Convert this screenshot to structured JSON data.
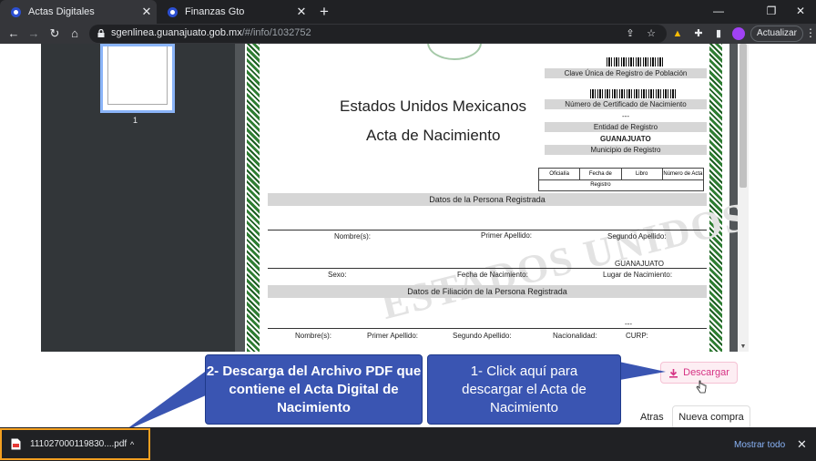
{
  "browser": {
    "tabs": [
      {
        "title": "Actas Digitales",
        "active": true
      },
      {
        "title": "Finanzas Gto",
        "active": false
      }
    ],
    "close_glyph": "✕",
    "new_tab_glyph": "+",
    "window_controls": {
      "minimize": "—",
      "restore": "❐",
      "close": "✕"
    },
    "nav": {
      "back": "←",
      "forward": "→",
      "reload": "↻",
      "home": "⌂"
    },
    "url": {
      "domain": "sgenlinea.guanajuato.gob.mx",
      "path": "/#/info/1032752"
    },
    "update_label": "Actualizar",
    "menu_glyph": "⋮",
    "icons": [
      "share-icon",
      "star-icon",
      "extension-icon",
      "puzzle-icon",
      "sidepanel-icon",
      "profile-icon"
    ]
  },
  "viewer": {
    "thumbnail_page": "1",
    "document": {
      "title_country": "Estados Unidos Mexicanos",
      "title_doc": "Acta de Nacimiento",
      "watermark": "ESTADOS UNIDOS MEXICANOS",
      "curp_label": "Clave Única de Registro de Población",
      "cert_label": "Número de Certificado de Nacimiento",
      "cert_value": "---",
      "entity_label": "Entidad de Registro",
      "entity_value": "GUANAJUATO",
      "municipality_label": "Municipio de Registro",
      "table_headers": [
        "Oficialía",
        "Fecha de Registro",
        "Libro",
        "Número de Acta"
      ],
      "section_registered": "Datos de la Persona Registrada",
      "fields_row1": [
        "Nombre(s):",
        "Primer Apellido:",
        "Segundo Apellido:"
      ],
      "place_value": "GUANAJUATO",
      "fields_row2": [
        "Sexo:",
        "Fecha de Nacimiento:",
        "Lugar de Nacimiento:"
      ],
      "section_parents": "Datos de Filiación de la Persona Registrada",
      "parent_dash": "---",
      "fields_row3": [
        "Nombre(s):",
        "Primer Apellido:",
        "Segundo Apellido:",
        "Nacionalidad:",
        "CURP:"
      ]
    }
  },
  "annotations": {
    "callout_left": "2- Descarga del Archivo PDF que contiene el Acta Digital de Nacimiento",
    "callout_right": "1- Click aquí para descargar el Acta de Nacimiento"
  },
  "buttons": {
    "download": "Descargar",
    "back": "Atras",
    "new_purchase": "Nueva compra"
  },
  "download_shelf": {
    "file_name": "111027000119830....pdf",
    "chevron": "^",
    "show_all": "Mostrar todo",
    "close_glyph": "✕"
  },
  "colors": {
    "callout": "#3a55b2",
    "download_text": "#d63384",
    "shelf_highlight": "#f4a020"
  }
}
